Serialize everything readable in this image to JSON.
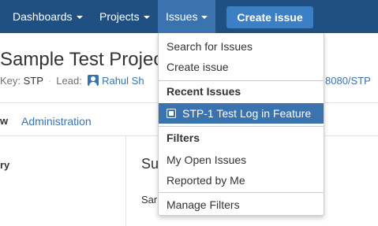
{
  "topnav": {
    "dashboards_label": "Dashboards",
    "projects_label": "Projects",
    "issues_label": "Issues",
    "create_issue_label": "Create issue"
  },
  "project": {
    "title": "Sample Test Project",
    "key_label": "Key:",
    "key_value": "STP",
    "lead_label": "Lead:",
    "lead_name": "Rahul Sh",
    "url_partial": "8080/STP"
  },
  "tabs": {
    "view_partial": "w",
    "administration": "Administration"
  },
  "left_column": {
    "heading_partial": "ry"
  },
  "main": {
    "summary_heading_partial": "Su",
    "summary_text_partial": "Sar"
  },
  "issues_menu": {
    "search_for_issues": "Search for Issues",
    "create_issue": "Create issue",
    "recent_issues_heading": "Recent Issues",
    "recent_issue_1": "STP-1 Test Log in Feature",
    "filters_heading": "Filters",
    "my_open_issues": "My Open Issues",
    "reported_by_me": "Reported by Me",
    "manage_filters": "Manage Filters"
  },
  "icons": {
    "caret": "chevron-down-icon",
    "avatar": "user-avatar-icon",
    "issue": "issue-type-icon"
  },
  "colors": {
    "nav_background": "#205081",
    "nav_active": "#3b73af",
    "create_button": "#3b7fc4",
    "link": "#3b73af",
    "highlight": "#3b73af"
  }
}
